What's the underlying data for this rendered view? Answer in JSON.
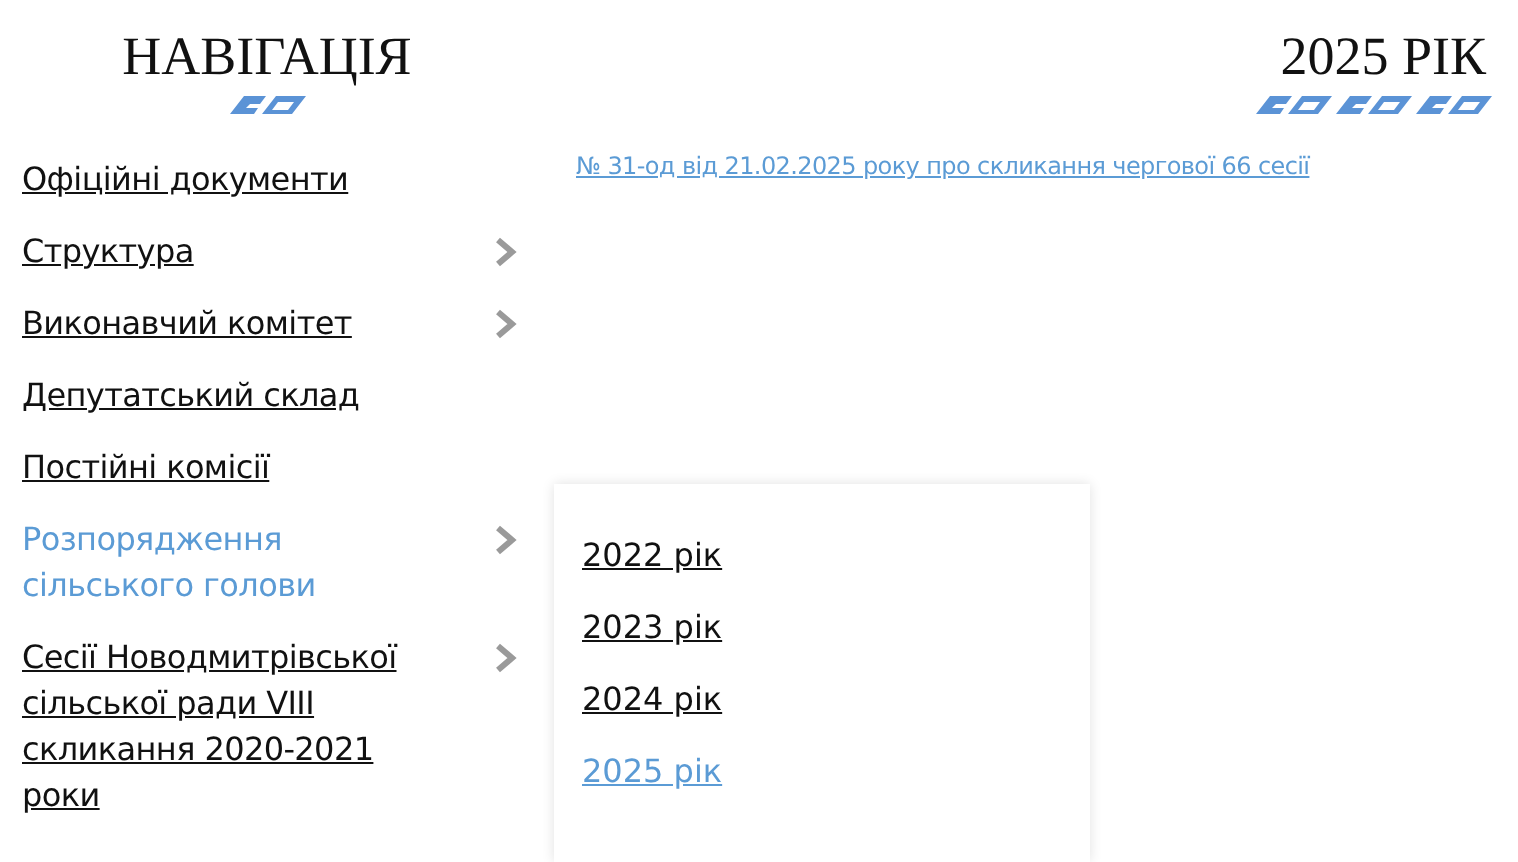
{
  "sidebar": {
    "title": "НАВІГАЦІЯ",
    "items": [
      {
        "label": "Офіційні документи",
        "selected": false,
        "has_submenu": false
      },
      {
        "label": "Структура",
        "selected": false,
        "has_submenu": true
      },
      {
        "label": "Виконавчий комітет",
        "selected": false,
        "has_submenu": true
      },
      {
        "label": "Депутатський склад",
        "selected": false,
        "has_submenu": false
      },
      {
        "label": "Постійні комісії",
        "selected": false,
        "has_submenu": false
      },
      {
        "label": "Розпорядження сільського голови",
        "selected": true,
        "has_submenu": true
      },
      {
        "label": "Сесії Новодмитрівської сільської ради VIII скликання 2020-2021 роки",
        "selected": false,
        "has_submenu": true
      }
    ]
  },
  "submenu": {
    "items": [
      {
        "label": "2022 рік",
        "selected": false
      },
      {
        "label": "2023 рік",
        "selected": false
      },
      {
        "label": "2024 рік",
        "selected": false
      },
      {
        "label": "2025 рік",
        "selected": true
      }
    ]
  },
  "content": {
    "title": "2025 РІК",
    "documents": [
      "№ 31-од від 21.02.2025 року про скликання чергової 66  сесії"
    ]
  }
}
